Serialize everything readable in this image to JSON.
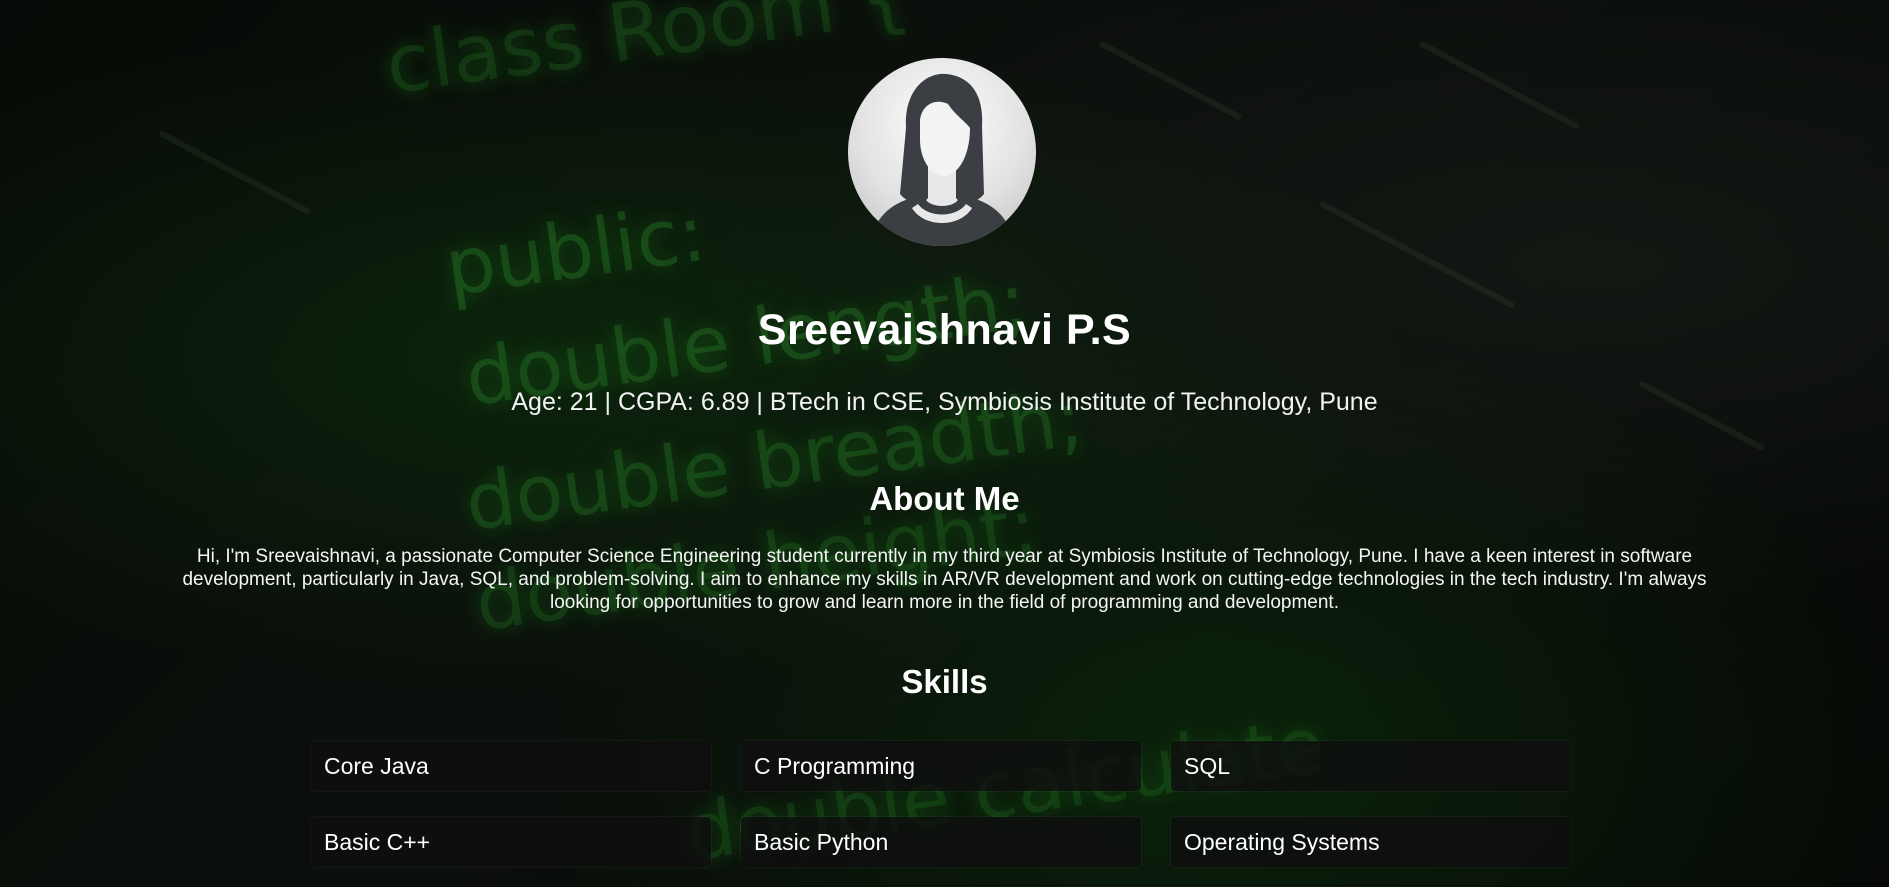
{
  "profile": {
    "name": "Sreevaishnavi P.S",
    "subtitle": "Age: 21 | CGPA: 6.89 | BTech in CSE, Symbiosis Institute of Technology, Pune",
    "avatar_icon": "female-avatar-icon"
  },
  "about": {
    "title": "About Me",
    "text": "Hi, I'm Sreevaishnavi, a passionate Computer Science Engineering student currently in my third year at Symbiosis Institute of Technology, Pune. I have a keen interest in software development, particularly in Java, SQL, and problem-solving. I aim to enhance my skills in AR/VR development and work on cutting-edge technologies in the tech industry. I'm always looking for opportunities to grow and learn more in the field of programming and development."
  },
  "skills": {
    "title": "Skills",
    "items": [
      "Core Java",
      "C Programming",
      "SQL",
      "Basic C++",
      "Basic Python",
      "Operating Systems"
    ]
  },
  "background": {
    "code_snippets": [
      "class Room {",
      "public:",
      "double length;",
      "double breadth;",
      "double height;",
      "double calculate"
    ],
    "accent_color": "#3cc83c"
  },
  "colors": {
    "text": "#ffffff",
    "card_background": "#0f0f0f"
  }
}
